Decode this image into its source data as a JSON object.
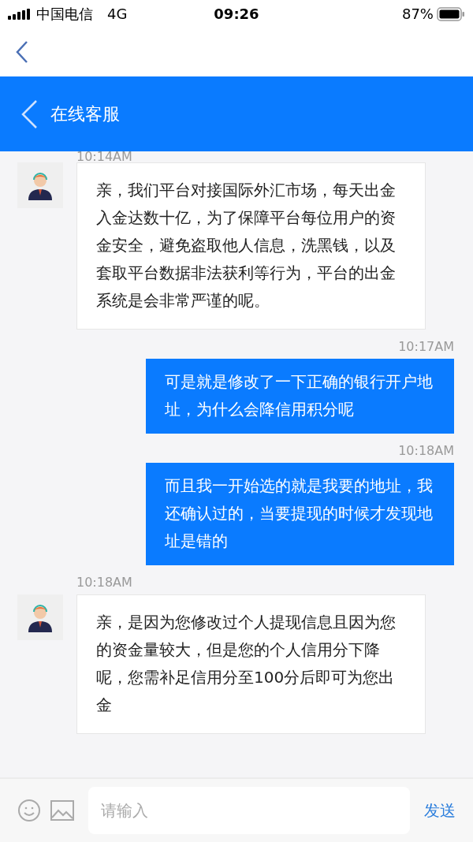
{
  "status_bar": {
    "carrier": "中国电信",
    "network": "4G",
    "time": "09:26",
    "battery": "87%"
  },
  "header": {
    "title": "在线客服"
  },
  "messages": [
    {
      "kind": "time",
      "text": "10:14AM"
    },
    {
      "kind": "agent",
      "text": "亲，我们平台对接国际外汇市场，每天出金入金达数十亿，为了保障平台每位用户的资金安全，避免盗取他人信息，洗黑钱，以及套取平台数据非法获利等行为，平台的出金系统是会非常严谨的呢。"
    },
    {
      "kind": "time",
      "text": "10:17AM"
    },
    {
      "kind": "user",
      "text": "可是就是修改了一下正确的银行开户地址，为什么会降信用积分呢"
    },
    {
      "kind": "time",
      "text": "10:18AM"
    },
    {
      "kind": "user",
      "text": "而且我一开始选的就是我要的地址，我还确认过的，当要提现的时候才发现地址是错的"
    },
    {
      "kind": "time",
      "text": "10:18AM"
    },
    {
      "kind": "agent",
      "text": "亲，是因为您修改过个人提现信息且因为您的资金量较大，但是您的个人信用分下降呢，您需补足信用分至100分后即可为您出金"
    }
  ],
  "input_bar": {
    "placeholder": "请输入",
    "send": "发送"
  }
}
